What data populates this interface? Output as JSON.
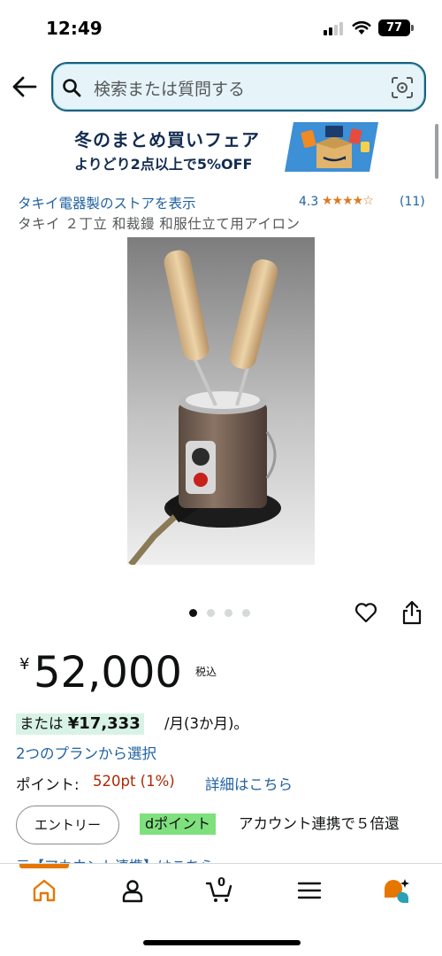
{
  "status_bar": {
    "time": "12:49",
    "battery": "77"
  },
  "header": {
    "search_placeholder": "検索または質問する"
  },
  "banner": {
    "line1": "冬のまとめ買いフェア",
    "line2": "よりどり2点以上で5%OFF"
  },
  "store": {
    "link": "タキイ電器製のストアを表示",
    "rating": "4.3",
    "stars": "★★★★☆",
    "rating_count": "(11)"
  },
  "product": {
    "title": "タキイ ２丁立 和裁鏝 和服仕立て用アイロン"
  },
  "gallery": {
    "image_count": 4,
    "active_index": 0
  },
  "price": {
    "currency": "¥",
    "amount": "52,000",
    "tax_note": "税込",
    "installment_prefix": "または",
    "installment_amount": "¥17,333",
    "installment_suffix": "/月(3か月)。",
    "plans_link": "2つのプランから選択"
  },
  "points": {
    "label": "ポイント:",
    "value": "520pt  (1%)",
    "details_link": "詳細はこちら"
  },
  "entry": {
    "button_label": "エントリー",
    "dpoint_badge": "dポイント",
    "dpoint_text": "アカウント連携で５倍還"
  },
  "footer_cutoff": "元【アカウント連携】はこちら",
  "nav": {
    "cart_count": "0",
    "active": "home"
  },
  "colors": {
    "accent": "#e77600",
    "link": "#2162a1",
    "price_red": "#b12704",
    "star": "#de7921",
    "installment_bg": "#d8f3e6",
    "dpoint_bg": "#7fe07e"
  }
}
